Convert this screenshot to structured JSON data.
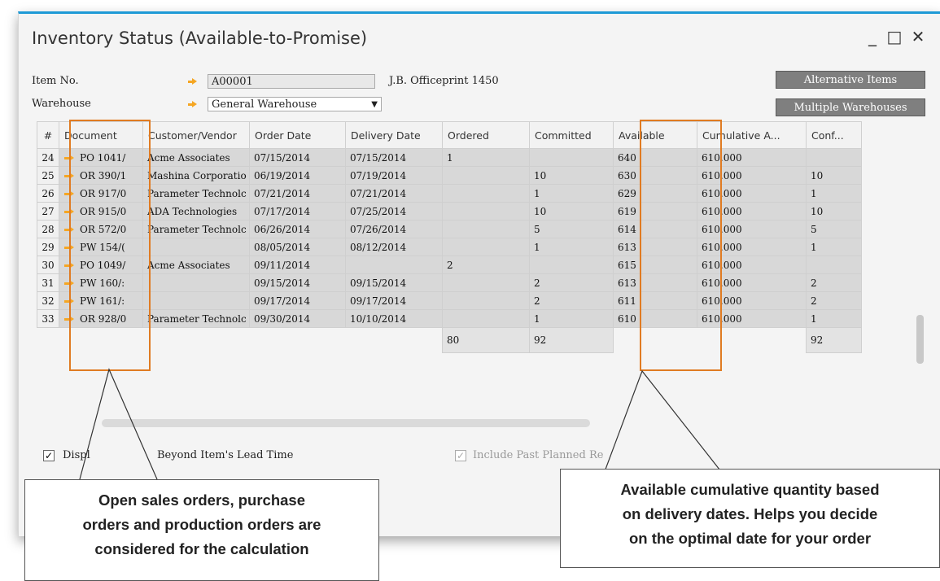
{
  "window": {
    "title": "Inventory Status (Available-to-Promise)",
    "minimize": "_",
    "maximize": "□",
    "close": "✕"
  },
  "form": {
    "item_no_label": "Item No.",
    "item_no_value": "A00001",
    "item_description": "J.B. Officeprint 1450",
    "warehouse_label": "Warehouse",
    "warehouse_value": "General Warehouse",
    "alt_items_button": "Alternative Items",
    "multi_wh_button": "Multiple Warehouses"
  },
  "table": {
    "headers": [
      "#",
      "Document",
      "Customer/Vendor",
      "Order Date",
      "Delivery Date",
      "Ordered",
      "Committed",
      "Available",
      "Cumulative A...",
      "Conf..."
    ],
    "rows": [
      [
        "24",
        "PO 1041/",
        "Acme Associates",
        "07/15/2014",
        "07/15/2014",
        "1",
        "",
        "640",
        "610.000",
        ""
      ],
      [
        "25",
        "OR 390/1",
        "Mashina Corporatio",
        "06/19/2014",
        "07/19/2014",
        "",
        "10",
        "630",
        "610.000",
        "10"
      ],
      [
        "26",
        "OR 917/0",
        "Parameter Technolc",
        "07/21/2014",
        "07/21/2014",
        "",
        "1",
        "629",
        "610.000",
        "1"
      ],
      [
        "27",
        "OR 915/0",
        "ADA Technologies",
        "07/17/2014",
        "07/25/2014",
        "",
        "10",
        "619",
        "610.000",
        "10"
      ],
      [
        "28",
        "OR 572/0",
        "Parameter Technolc",
        "06/26/2014",
        "07/26/2014",
        "",
        "5",
        "614",
        "610.000",
        "5"
      ],
      [
        "29",
        "PW 154/(",
        "",
        "08/05/2014",
        "08/12/2014",
        "",
        "1",
        "613",
        "610.000",
        "1"
      ],
      [
        "30",
        "PO 1049/",
        "Acme Associates",
        "09/11/2014",
        "",
        "2",
        "",
        "615",
        "610.000",
        ""
      ],
      [
        "31",
        "PW 160/:",
        "",
        "09/15/2014",
        "09/15/2014",
        "",
        "2",
        "613",
        "610.000",
        "2"
      ],
      [
        "32",
        "PW 161/:",
        "",
        "09/17/2014",
        "09/17/2014",
        "",
        "2",
        "611",
        "610.000",
        "2"
      ],
      [
        "33",
        "OR 928/0",
        "Parameter Technolc",
        "09/30/2014",
        "10/10/2014",
        "",
        "1",
        "610",
        "610.000",
        "1"
      ]
    ],
    "totals": {
      "ordered": "80",
      "committed": "92",
      "confirmed": "92"
    }
  },
  "options": {
    "display_beyond_label": "Displ",
    "display_beyond_label_tail": "Beyond Item's Lead Time",
    "display_beyond_checked": "✓",
    "include_past_label": "Include Past Planned Re",
    "include_past_checked": "✓"
  },
  "callouts": {
    "left": [
      "Open sales orders, purchase",
      "orders and production orders are",
      "considered for the calculation"
    ],
    "right": [
      "Available cumulative quantity based",
      "on delivery dates. Helps you decide",
      "on the optimal date for your order"
    ]
  },
  "colors": {
    "accent_border": "#1e9ad6",
    "highlight": "#e07b22",
    "arrow": "#f5a623",
    "button_bg": "#7f7f7f"
  }
}
